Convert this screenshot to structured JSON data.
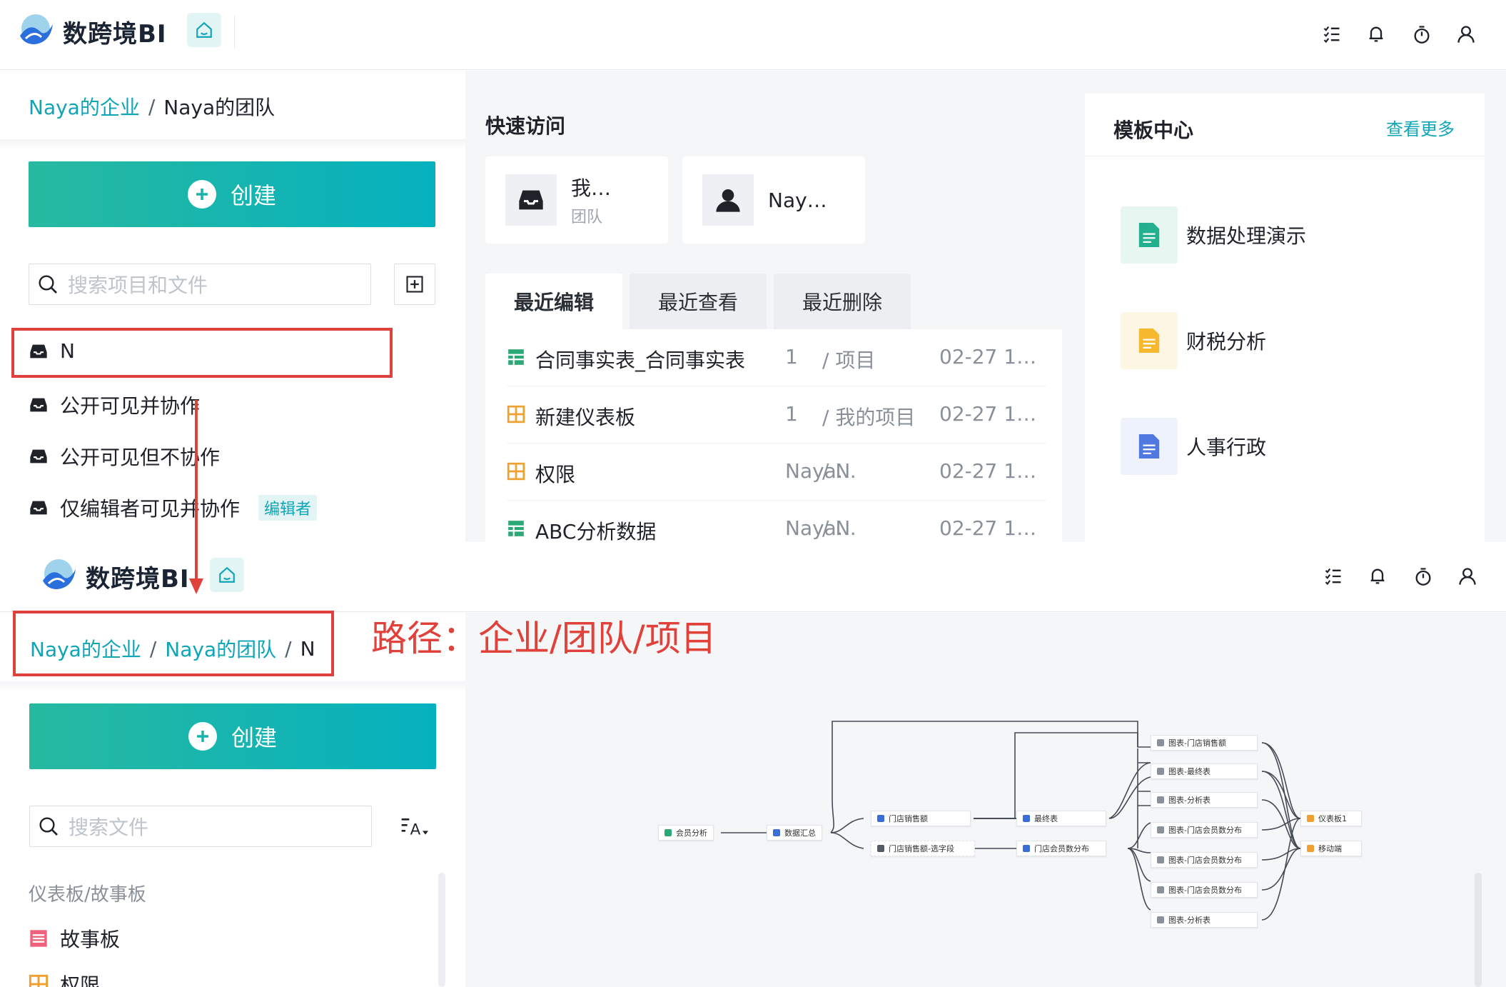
{
  "app": {
    "brand": "数跨境BI"
  },
  "top_panel": {
    "breadcrumb": {
      "enterprise": "Naya的企业",
      "separator": "/",
      "team": "Naya的团队"
    },
    "create_label": "创建",
    "search_placeholder": "搜索项目和文件",
    "projects": [
      {
        "label": "N"
      },
      {
        "label": "公开可见并协作"
      },
      {
        "label": "公开可见但不协作"
      },
      {
        "label": "仅编辑者可见并协作",
        "badge": "编辑者"
      }
    ],
    "quick_access": {
      "title": "快速访问",
      "cards": [
        {
          "name": "我…",
          "sub": "团队"
        },
        {
          "name": "Nay…"
        }
      ]
    },
    "tabs": [
      "最近编辑",
      "最近查看",
      "最近删除"
    ],
    "recent": [
      {
        "name": "合同事实表_合同事实表",
        "col1": "1",
        "col2": "/ 项目",
        "date": "02-27 1…",
        "icon": "table-icon"
      },
      {
        "name": "新建仪表板",
        "col1": "1",
        "col2": "/ 我的项目",
        "date": "02-27 1…",
        "icon": "dashboard-icon"
      },
      {
        "name": "权限",
        "col1": "Naya…",
        "col2": "/ N",
        "date": "02-27 1…",
        "icon": "dashboard-icon"
      },
      {
        "name": "ABC分析数据",
        "col1": "Naya…",
        "col2": "/ N",
        "date": "02-27 1…",
        "icon": "table-icon"
      }
    ],
    "templates": {
      "title": "模板中心",
      "more": "查看更多",
      "items": [
        {
          "label": "数据处理演示",
          "color": "#23b08f"
        },
        {
          "label": "财税分析",
          "color": "#f5b82e"
        },
        {
          "label": "人事行政",
          "color": "#4f78e0"
        }
      ]
    }
  },
  "bottom_panel": {
    "breadcrumb": {
      "enterprise": "Naya的企业",
      "separator1": "/",
      "team": "Naya的团队",
      "separator2": "/",
      "project": "N"
    },
    "create_label": "创建",
    "search_placeholder": "搜索文件",
    "section_label": "仪表板/故事板",
    "items": [
      {
        "label": "故事板"
      },
      {
        "label": "权限"
      }
    ],
    "dag_nodes": [
      {
        "label": "会员分析",
        "color": "#2aa876"
      },
      {
        "label": "数据汇总",
        "color": "#3b6fd8"
      },
      {
        "label": "门店销售额",
        "color": "#3b6fd8"
      },
      {
        "label": "门店销售额-选字段",
        "color": "#555b66"
      },
      {
        "label": "最终表",
        "color": "#3b6fd8"
      },
      {
        "label": "门店会员数分布",
        "color": "#3b6fd8"
      },
      {
        "label": "图表-门店销售额",
        "color": "#8a9099"
      },
      {
        "label": "图表-最终表",
        "color": "#8a9099"
      },
      {
        "label": "图表-分析表",
        "color": "#8a9099"
      },
      {
        "label": "图表-门店会员数分布",
        "color": "#8a9099"
      },
      {
        "label": "图表-门店会员数分布",
        "color": "#8a9099"
      },
      {
        "label": "图表-门店会员数分布",
        "color": "#8a9099"
      },
      {
        "label": "图表-分析表",
        "color": "#8a9099"
      },
      {
        "label": "仪表板1",
        "color": "#f0a030"
      },
      {
        "label": "移动端",
        "color": "#f0a030"
      }
    ]
  },
  "annotation": {
    "text": "路径：企业/团队/项目",
    "color": "#e0413a"
  },
  "colors": {
    "accent": "#0ea5b7",
    "create_gradient_start": "#27b9a0",
    "create_gradient_end": "#06b1bf"
  }
}
